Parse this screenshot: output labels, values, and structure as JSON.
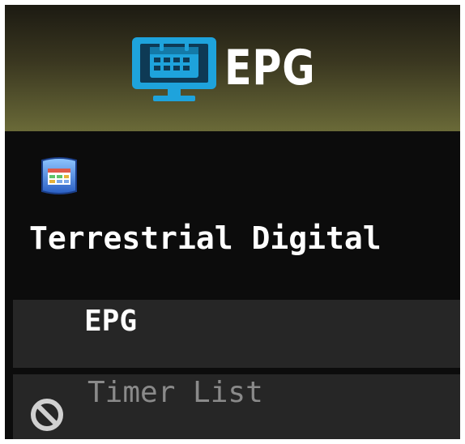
{
  "header": {
    "title": "EPG",
    "icon": "epg-monitor-icon",
    "accent_color": "#1ea3dc"
  },
  "source": {
    "icon": "tv-guide-icon",
    "label": "Terrestrial Digital"
  },
  "menu": {
    "items": [
      {
        "label": "EPG",
        "enabled": true
      },
      {
        "label": "Timer List",
        "enabled": false,
        "icon": "disabled-icon"
      }
    ]
  }
}
